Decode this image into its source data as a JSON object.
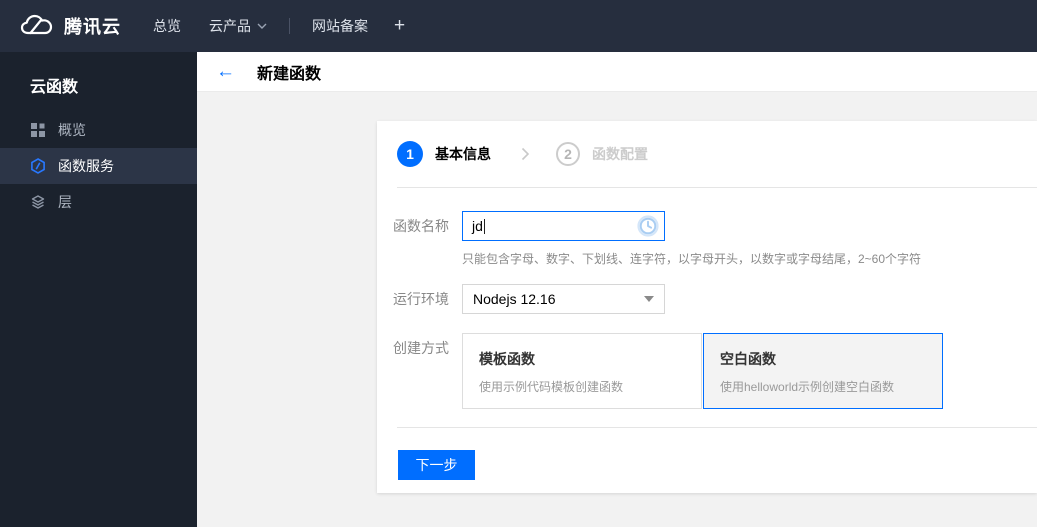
{
  "navbar": {
    "brand": {
      "label": "腾讯云",
      "icon": "tencent-cloud-logo"
    },
    "items": [
      {
        "label": "总览"
      },
      {
        "label": "云产品",
        "caret": true
      },
      {
        "label": "网站备案"
      },
      {
        "label": "+"
      }
    ]
  },
  "sidebar": {
    "title": "云函数",
    "items": [
      {
        "label": "概览",
        "icon": "grid-overview-icon",
        "active": false
      },
      {
        "label": "函数服务",
        "icon": "function-service-icon",
        "active": true
      },
      {
        "label": "层",
        "icon": "layers-icon",
        "active": false
      }
    ]
  },
  "header": {
    "title": "新建函数",
    "back_icon": "arrow-left-icon"
  },
  "wizard": {
    "steps": [
      {
        "number": "1",
        "label": "基本信息",
        "state": "active"
      },
      {
        "number": "2",
        "label": "函数配置",
        "state": "upcoming"
      }
    ]
  },
  "form": {
    "name_field": {
      "label": "函数名称",
      "value": "jd",
      "helper": "只能包含字母、数字、下划线、连字符，以字母开头，以数字或字母结尾，2~60个字符",
      "status_icon": "validating-clock-icon"
    },
    "runtime_field": {
      "label": "运行环境",
      "value": "Nodejs 12.16"
    },
    "method_field": {
      "label": "创建方式",
      "options": [
        {
          "title": "模板函数",
          "description": "使用示例代码模板创建函数",
          "selected": false
        },
        {
          "title": "空白函数",
          "description": "使用helloworld示例创建空白函数",
          "selected": true
        }
      ]
    }
  },
  "actions": {
    "next": "下一步"
  },
  "colors": {
    "accent": "#006eff",
    "topnav_bg": "#262e3e",
    "sidebar_bg": "#1b222d",
    "sidebar_active_bg": "#2c3547",
    "content_bg": "#f2f2f2",
    "selected_card_bg": "#f3f3f3"
  }
}
